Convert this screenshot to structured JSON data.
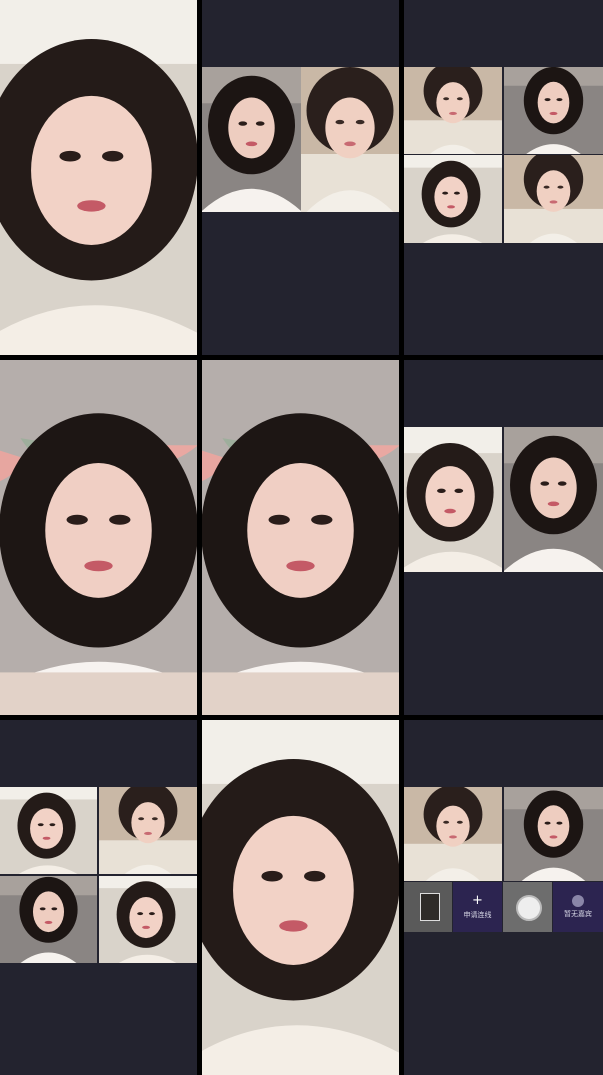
{
  "grid": {
    "cells": [
      {
        "id": "c1",
        "participants": 1
      },
      {
        "id": "c2",
        "participants": 2
      },
      {
        "id": "c3",
        "participants": 4
      },
      {
        "id": "c4",
        "participants": 1
      },
      {
        "id": "c5",
        "participants": 1
      },
      {
        "id": "c6",
        "participants": 2
      },
      {
        "id": "c7",
        "participants": 4
      },
      {
        "id": "c8",
        "participants": 1
      },
      {
        "id": "c9",
        "participants": 2
      }
    ]
  },
  "cohost_bar": {
    "apply_label": "申请连线",
    "empty_label": "暂无嘉宾",
    "apply_icon": "plus-icon",
    "empty_icon": "person-icon"
  },
  "colors": {
    "background": "#000000",
    "cell_bg": "#23232f",
    "bar_purple": "#2c2450",
    "bar_gray": "#4a4a4a"
  }
}
